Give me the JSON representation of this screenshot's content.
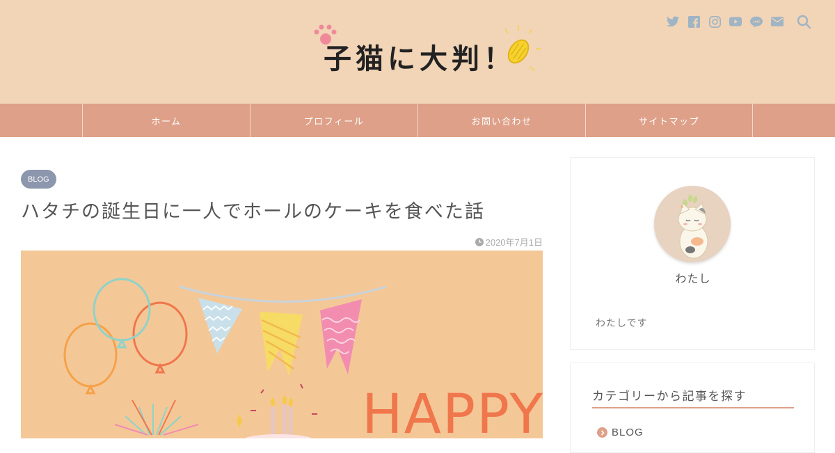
{
  "header": {
    "logo_text": "子猫に大判！",
    "social_icons": [
      "twitter-icon",
      "facebook-icon",
      "instagram-icon",
      "youtube-icon",
      "line-icon",
      "mail-icon",
      "search-icon"
    ]
  },
  "nav": {
    "items": [
      {
        "label": "ホーム"
      },
      {
        "label": "プロフィール"
      },
      {
        "label": "お問い合わせ"
      },
      {
        "label": "サイトマップ"
      }
    ]
  },
  "post": {
    "category": "BLOG",
    "title": "ハタチの誕生日に一人でホールのケーキを食べた話",
    "date": "2020年7月1日",
    "eyecatch_text": "HAPPY"
  },
  "sidebar": {
    "profile": {
      "name": "わたし",
      "description": "わたしです"
    },
    "category_widget": {
      "title": "カテゴリーから記事を探す",
      "items": [
        {
          "label": "BLOG"
        }
      ]
    }
  },
  "colors": {
    "header_bg": "#f2d4b7",
    "nav_bg": "#dea088",
    "badge_bg": "#8c96ad",
    "eyecatch_bg": "#f4c797",
    "accent": "#dea088"
  }
}
